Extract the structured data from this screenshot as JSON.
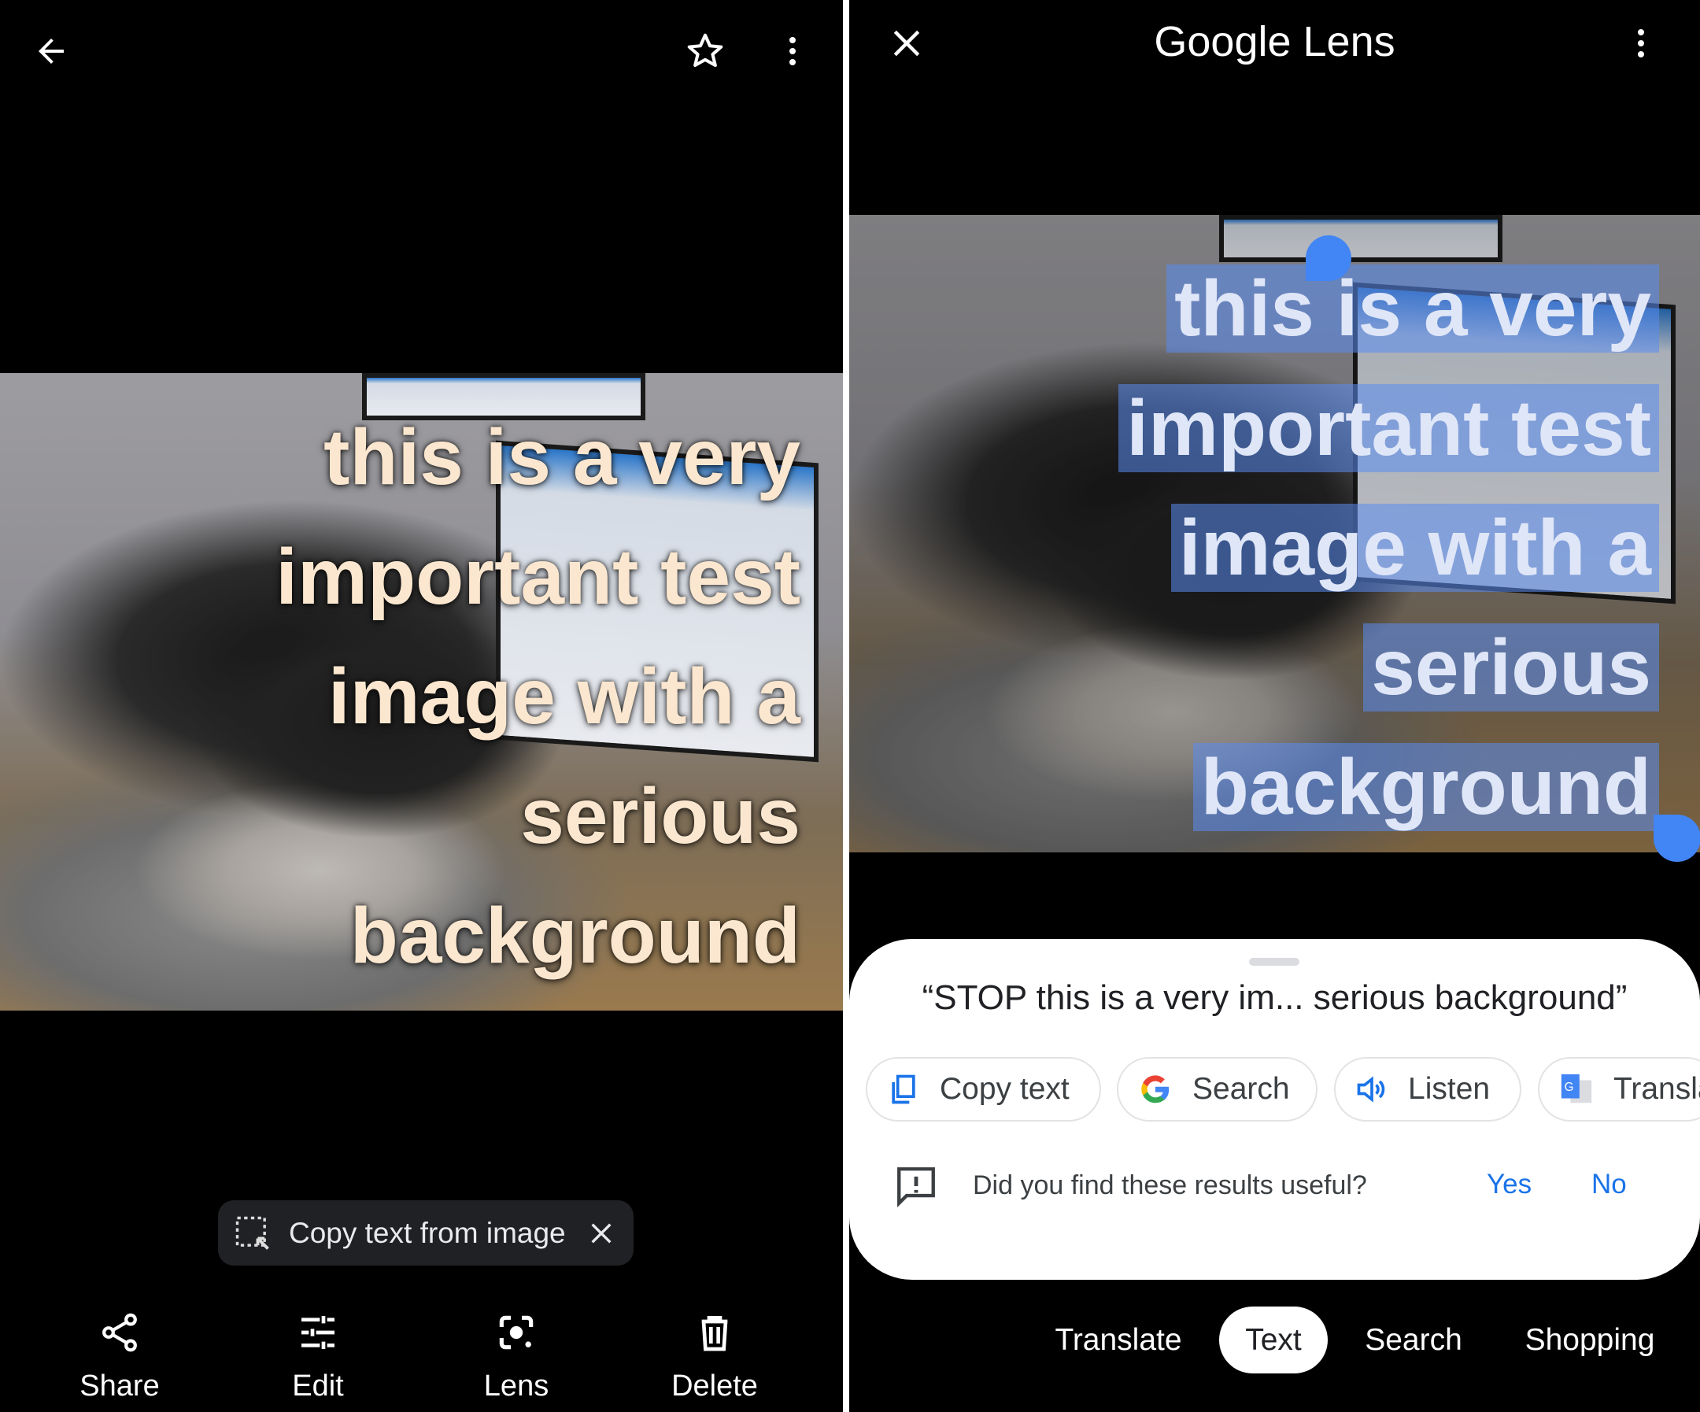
{
  "left": {
    "top_bar": {
      "back": "arrow-left-icon",
      "favorite": "star-icon",
      "more": "more-vert-icon"
    },
    "image_text_lines": [
      "this is a very",
      "important test",
      "image with a",
      "serious",
      "background"
    ],
    "copy_chip": {
      "label": "Copy text from image",
      "icon": "text-select-icon",
      "close": "close-icon"
    },
    "bottom_nav": [
      {
        "label": "Share",
        "icon": "share-icon"
      },
      {
        "label": "Edit",
        "icon": "tune-icon"
      },
      {
        "label": "Lens",
        "icon": "lens-icon"
      },
      {
        "label": "Delete",
        "icon": "trash-icon"
      }
    ]
  },
  "right": {
    "header": {
      "title": "Google Lens",
      "close": "close-icon",
      "more": "more-vert-icon"
    },
    "image_text_lines": [
      "this is a very",
      "important test",
      "image with a",
      "serious",
      "background"
    ],
    "sheet": {
      "quote": "“STOP this is a very im... serious background”",
      "chips": [
        {
          "label": "Copy text",
          "icon": "copy-icon"
        },
        {
          "label": "Search",
          "icon": "google-g-icon"
        },
        {
          "label": "Listen",
          "icon": "speaker-icon"
        },
        {
          "label": "Transla",
          "icon": "google-translate-icon"
        }
      ],
      "feedback": {
        "question": "Did you find these results useful?",
        "yes": "Yes",
        "no": "No"
      }
    },
    "tabs": [
      {
        "label": "Translate",
        "selected": false
      },
      {
        "label": "Text",
        "selected": true
      },
      {
        "label": "Search",
        "selected": false
      },
      {
        "label": "Shopping",
        "selected": false
      }
    ],
    "accent": "#1a73e8"
  }
}
